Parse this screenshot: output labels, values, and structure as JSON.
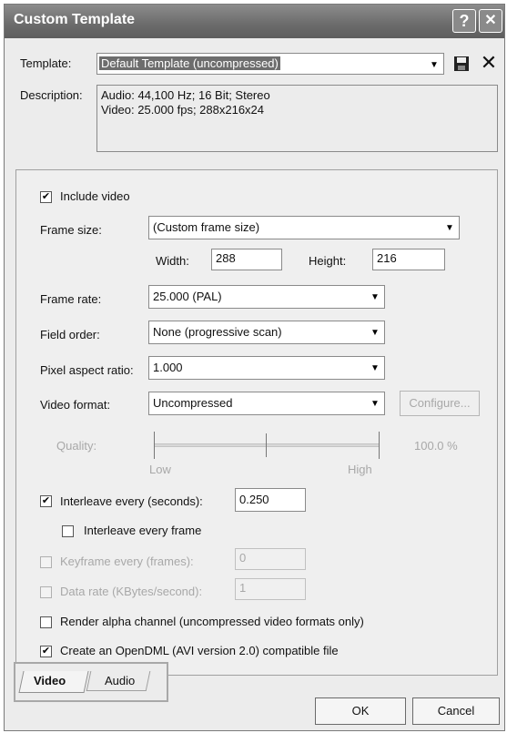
{
  "window": {
    "title": "Custom Template",
    "help_glyph": "?",
    "close_glyph": "✕"
  },
  "template": {
    "label": "Template:",
    "value": "Default Template (uncompressed)",
    "save_icon": "save-icon",
    "delete_icon": "delete-icon"
  },
  "description": {
    "label": "Description:",
    "line1": "Audio: 44,100 Hz; 16 Bit; Stereo",
    "line2": "Video: 25.000 fps; 288x216x24"
  },
  "video": {
    "include_label": "Include video",
    "include_checked": true,
    "frame_size_label": "Frame size:",
    "frame_size_value": "(Custom frame size)",
    "width_label": "Width:",
    "width_value": "288",
    "height_label": "Height:",
    "height_value": "216",
    "frame_rate_label": "Frame rate:",
    "frame_rate_value": "25.000 (PAL)",
    "field_order_label": "Field order:",
    "field_order_value": "None (progressive scan)",
    "pixel_aspect_label": "Pixel aspect ratio:",
    "pixel_aspect_value": "1.000",
    "video_format_label": "Video format:",
    "video_format_value": "Uncompressed",
    "configure_label": "Configure...",
    "quality_label": "Quality:",
    "quality_value": "100.0 %",
    "quality_level": 1.0,
    "low_label": "Low",
    "high_label": "High",
    "interleave_label": "Interleave every (seconds):",
    "interleave_checked": true,
    "interleave_value": "0.250",
    "interleave_frame_label": "Interleave every frame",
    "interleave_frame_checked": false,
    "keyframe_label": "Keyframe every (frames):",
    "keyframe_value": "0",
    "datarate_label": "Data rate (KBytes/second):",
    "datarate_value": "1",
    "alpha_label": "Render alpha channel (uncompressed video formats only)",
    "alpha_checked": false,
    "opendml_label": "Create an OpenDML (AVI version 2.0) compatible file",
    "opendml_checked": true
  },
  "tabs": [
    {
      "label": "Video",
      "active": true
    },
    {
      "label": "Audio",
      "active": false
    }
  ],
  "buttons": {
    "ok": "OK",
    "cancel": "Cancel"
  }
}
